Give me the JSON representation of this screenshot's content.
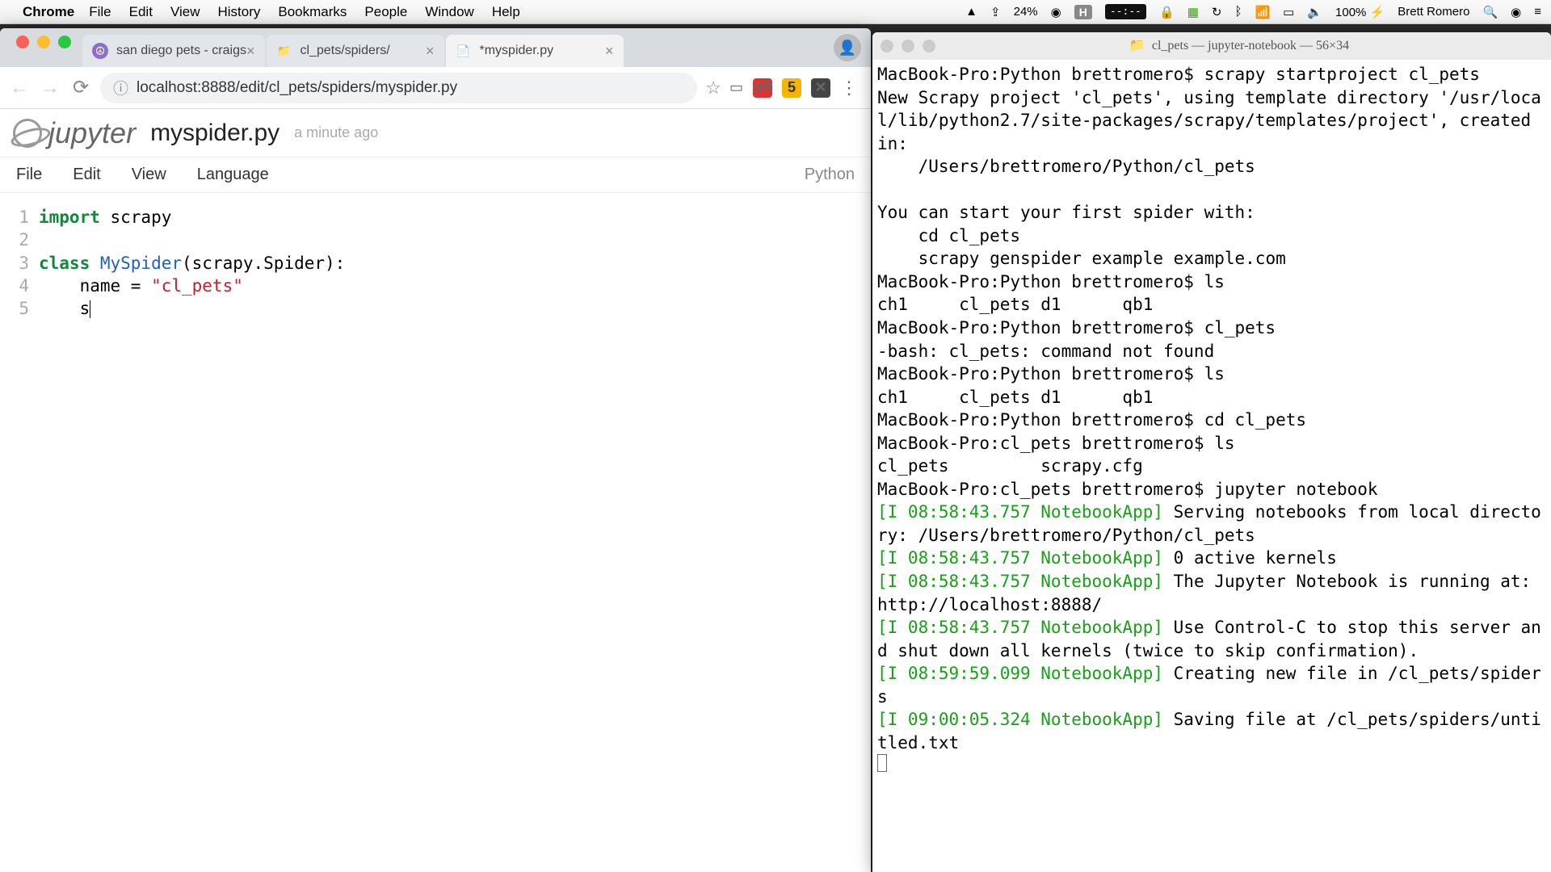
{
  "menubar": {
    "app": "Chrome",
    "items": [
      "File",
      "Edit",
      "View",
      "History",
      "Bookmarks",
      "People",
      "Window",
      "Help"
    ],
    "zoom": "24%",
    "hammer": "H",
    "pill": "--:--",
    "battery": "100% ⚡",
    "user": "Brett Romero"
  },
  "chrome": {
    "tabs": [
      {
        "title": "san diego pets - craigs",
        "favicon": "☮",
        "active": false
      },
      {
        "title": "cl_pets/spiders/",
        "favicon": "📁",
        "active": false
      },
      {
        "title": "*myspider.py",
        "favicon": "📄",
        "active": true
      }
    ],
    "url": "localhost:8888/edit/cl_pets/spiders/myspider.py",
    "ext_off": "off"
  },
  "jupyter": {
    "logo": "jupyter",
    "filename": "myspider.py",
    "timestamp": "a minute ago",
    "menus": [
      "File",
      "Edit",
      "View",
      "Language"
    ],
    "kernel": "Python"
  },
  "code": {
    "lines": [
      "1",
      "2",
      "3",
      "4",
      "5"
    ],
    "l1a": "import",
    "l1b": " scrapy",
    "l3a": "class ",
    "l3b": "MySpider",
    "l3c": "(scrapy.Spider):",
    "l4a": "    name = ",
    "l4b": "\"cl_pets\"",
    "l5a": "    s"
  },
  "terminal": {
    "title": "cl_pets — jupyter-notebook — 56×34",
    "t01": "MacBook-Pro:Python brettromero$ scrapy startproject cl_pets",
    "t02": "New Scrapy project 'cl_pets', using template directory '/usr/local/lib/python2.7/site-packages/scrapy/templates/project', created in:",
    "t03": "    /Users/brettromero/Python/cl_pets",
    "t04": "",
    "t05": "You can start your first spider with:",
    "t06": "    cd cl_pets",
    "t07": "    scrapy genspider example example.com",
    "t08": "MacBook-Pro:Python brettromero$ ls",
    "t09": "ch1     cl_pets d1      qb1",
    "t10": "MacBook-Pro:Python brettromero$ cl_pets",
    "t11": "-bash: cl_pets: command not found",
    "t12": "MacBook-Pro:Python brettromero$ ls",
    "t13": "ch1     cl_pets d1      qb1",
    "t14": "MacBook-Pro:Python brettromero$ cd cl_pets",
    "t15": "MacBook-Pro:cl_pets brettromero$ ls",
    "t16": "cl_pets         scrapy.cfg",
    "t17": "MacBook-Pro:cl_pets brettromero$ jupyter notebook",
    "g1": "[I 08:58:43.757 NotebookApp]",
    "t18": " Serving notebooks from local directory: /Users/brettromero/Python/cl_pets",
    "g2": "[I 08:58:43.757 NotebookApp]",
    "t19": " 0 active kernels",
    "g3": "[I 08:58:43.757 NotebookApp]",
    "t20": " The Jupyter Notebook is running at: http://localhost:8888/",
    "g4": "[I 08:58:43.757 NotebookApp]",
    "t21": " Use Control-C to stop this server and shut down all kernels (twice to skip confirmation).",
    "g5": "[I 08:59:59.099 NotebookApp]",
    "t22": " Creating new file in /cl_pets/spiders",
    "g6": "[I 09:00:05.324 NotebookApp]",
    "t23": " Saving file at /cl_pets/spiders/untitled.txt"
  }
}
